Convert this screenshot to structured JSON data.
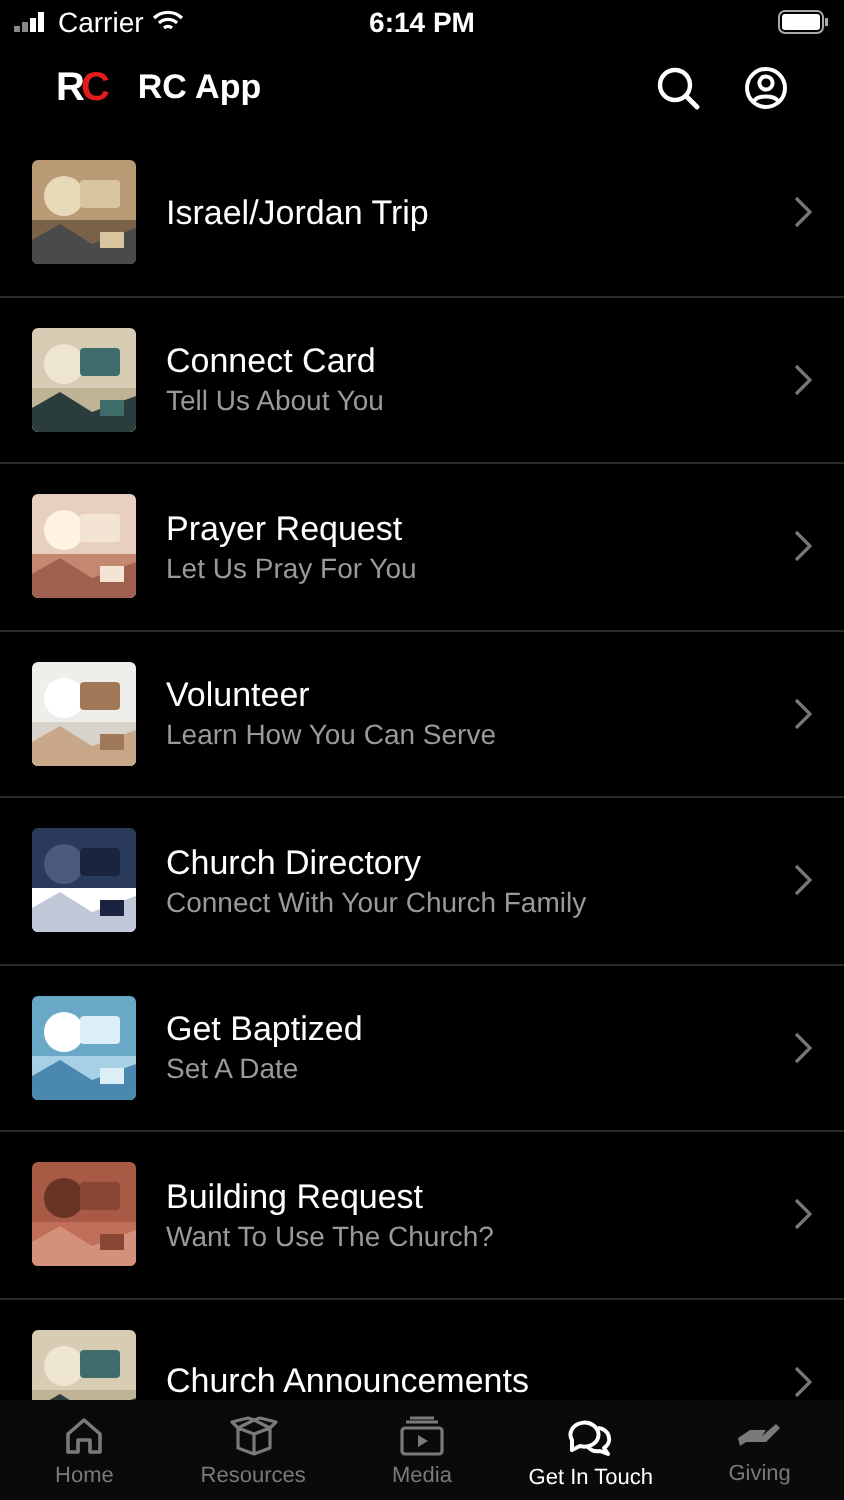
{
  "status_bar": {
    "carrier": "Carrier",
    "time": "6:14 PM"
  },
  "header": {
    "logo": "RC",
    "title": "RC App"
  },
  "items": [
    {
      "title": "Israel/Jordan Trip"
    },
    {
      "title": "Connect Card",
      "subtitle": "Tell Us About You"
    },
    {
      "title": "Prayer Request",
      "subtitle": "Let Us Pray For You"
    },
    {
      "title": "Volunteer",
      "subtitle": "Learn How You Can Serve"
    },
    {
      "title": "Church Directory",
      "subtitle": "Connect With Your Church Family"
    },
    {
      "title": "Get Baptized",
      "subtitle": "Set A Date"
    },
    {
      "title": "Building Request",
      "subtitle": "Want To Use The Church?"
    },
    {
      "title": "Church Announcements"
    }
  ],
  "tab_bar": [
    {
      "label": "Home",
      "selected": false
    },
    {
      "label": "Resources",
      "selected": false
    },
    {
      "label": "Media",
      "selected": false
    },
    {
      "label": "Get In Touch",
      "selected": true
    },
    {
      "label": "Giving",
      "selected": false
    }
  ]
}
